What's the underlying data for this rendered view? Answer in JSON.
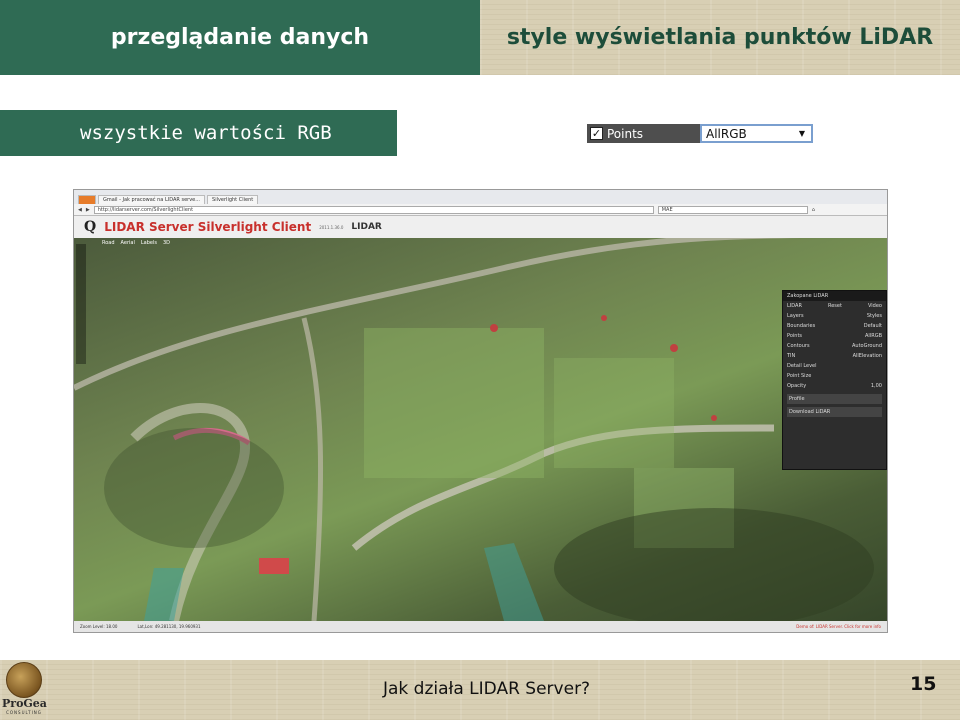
{
  "slide": {
    "header_left": "przeglądanie danych",
    "header_right": "style wyświetlania punktów LiDAR",
    "subheader": "wszystkie wartości RGB"
  },
  "layer_widget": {
    "checkbox_mark": "✓",
    "label": "Points",
    "selected_style": "AllRGB"
  },
  "browser": {
    "tabs": [
      "Gmail - Jak pracować na LIDAR serve...",
      "Silverlight Client"
    ],
    "url": "http://lidarserver.com/SilverlightClient",
    "search": "MAE",
    "app_title": "LIDAR Server Silverlight Client",
    "app_version": "2011.1.36.0",
    "lidar_logo": "LIDAR",
    "map_modes": [
      "Road",
      "Aerial",
      "Labels",
      "3D"
    ],
    "panel": {
      "title": "Zakopane LiDAR",
      "buttons": [
        "Reset",
        "Video"
      ],
      "layers_label": "Layers",
      "styles_label": "Styles",
      "rows": [
        {
          "layer": "Boundaries",
          "style": "Default"
        },
        {
          "layer": "Points",
          "style": "AllRGB"
        },
        {
          "layer": "Contours",
          "style": "AutoGround"
        },
        {
          "layer": "TIN",
          "style": "AllElevation"
        }
      ],
      "detail_level": "Detail Level",
      "point_size": "Point Size",
      "opacity": "Opacity",
      "opacity_value": "1,00",
      "profile": "Profile",
      "download": "Download LiDAR"
    },
    "status": {
      "zoom": "Zoom Level: 18.00",
      "latlon": "Lat,Lon: 49.281130, 19.960931",
      "demo": "Demo of: LIDAR Server. Click for more info"
    }
  },
  "footer": {
    "brand": "ProGea",
    "brand_sub": "CONSULTING",
    "text": "Jak działa LIDAR Server?",
    "page_number": "15"
  },
  "colors": {
    "green_header": "#2f6b54",
    "parchment": "#d8cfb4",
    "title_red": "#c8302c"
  }
}
